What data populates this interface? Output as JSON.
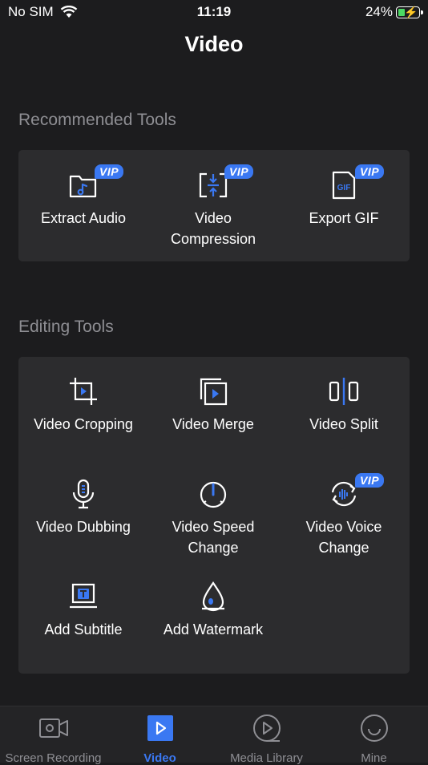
{
  "status": {
    "carrier": "No SIM",
    "time": "11:19",
    "battery": "24%"
  },
  "page": {
    "title": "Video"
  },
  "recommended": {
    "title": "Recommended Tools",
    "items": [
      {
        "label": "Extract Audio",
        "vip": "VIP",
        "icon": "music-folder-icon"
      },
      {
        "label": "Video Compression",
        "vip": "VIP",
        "icon": "compress-icon"
      },
      {
        "label": "Export GIF",
        "vip": "VIP",
        "icon": "gif-file-icon"
      }
    ]
  },
  "editing": {
    "title": "Editing Tools",
    "items": [
      {
        "label": "Video Cropping",
        "icon": "crop-icon"
      },
      {
        "label": "Video Merge",
        "icon": "merge-icon"
      },
      {
        "label": "Video Split",
        "icon": "split-icon"
      },
      {
        "label": "Video Dubbing",
        "icon": "microphone-icon"
      },
      {
        "label": "Video Speed Change",
        "icon": "speed-dial-icon"
      },
      {
        "label": "Video Voice Change",
        "vip": "VIP",
        "icon": "voice-change-icon"
      },
      {
        "label": "Add Subtitle",
        "icon": "subtitle-icon"
      },
      {
        "label": "Add Watermark",
        "icon": "watermark-icon"
      }
    ]
  },
  "tabs": [
    {
      "label": "Screen Recording",
      "icon": "camera-icon"
    },
    {
      "label": "Video",
      "icon": "play-icon",
      "active": true
    },
    {
      "label": "Media Library",
      "icon": "media-library-icon"
    },
    {
      "label": "Mine",
      "icon": "profile-icon"
    }
  ],
  "colors": {
    "accent": "#3a78f2",
    "background": "#1c1c1e",
    "card": "#2c2c2e",
    "muted": "#8e8e93"
  }
}
